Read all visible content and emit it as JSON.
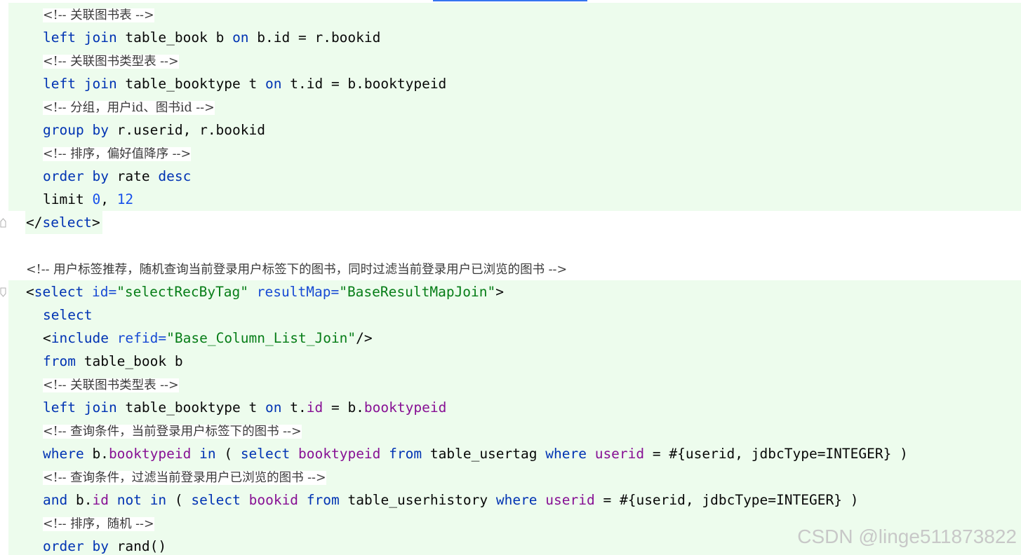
{
  "watermark": "CSDN @linge511873822",
  "lines": [
    {
      "kind": "comment",
      "tokens": [
        {
          "t": "<!-- 关联图书表 -->",
          "c": "cmt"
        }
      ]
    },
    {
      "kind": "code",
      "tokens": [
        {
          "t": "left",
          "c": "kw"
        },
        {
          "t": " ",
          "c": "txt"
        },
        {
          "t": "join",
          "c": "kw"
        },
        {
          "t": " table_book b ",
          "c": "txt"
        },
        {
          "t": "on",
          "c": "kw"
        },
        {
          "t": " b.id = r.bookid",
          "c": "txt"
        }
      ]
    },
    {
      "kind": "comment",
      "tokens": [
        {
          "t": "<!-- 关联图书类型表 -->",
          "c": "cmt"
        }
      ]
    },
    {
      "kind": "code",
      "tokens": [
        {
          "t": "left",
          "c": "kw"
        },
        {
          "t": " ",
          "c": "txt"
        },
        {
          "t": "join",
          "c": "kw"
        },
        {
          "t": " table_booktype t ",
          "c": "txt"
        },
        {
          "t": "on",
          "c": "kw"
        },
        {
          "t": " t.id = b.booktypeid",
          "c": "txt"
        }
      ]
    },
    {
      "kind": "comment",
      "tokens": [
        {
          "t": "<!-- 分组，用户id、图书id -->",
          "c": "cmt"
        }
      ]
    },
    {
      "kind": "code",
      "tokens": [
        {
          "t": "group",
          "c": "kw"
        },
        {
          "t": " ",
          "c": "txt"
        },
        {
          "t": "by",
          "c": "kw"
        },
        {
          "t": " r.userid, r.bookid",
          "c": "txt"
        }
      ]
    },
    {
      "kind": "comment",
      "tokens": [
        {
          "t": "<!-- 排序，偏好值降序 -->",
          "c": "cmt"
        }
      ]
    },
    {
      "kind": "code",
      "tokens": [
        {
          "t": "order",
          "c": "kw"
        },
        {
          "t": " ",
          "c": "txt"
        },
        {
          "t": "by",
          "c": "kw"
        },
        {
          "t": " rate ",
          "c": "txt"
        },
        {
          "t": "desc",
          "c": "kw"
        }
      ]
    },
    {
      "kind": "code",
      "tokens": [
        {
          "t": "limit ",
          "c": "txt"
        },
        {
          "t": "0",
          "c": "num"
        },
        {
          "t": ", ",
          "c": "txt"
        },
        {
          "t": "12",
          "c": "num"
        }
      ]
    },
    {
      "kind": "close-tag",
      "tokens": [
        {
          "t": "</",
          "c": "txt"
        },
        {
          "t": "select",
          "c": "tag"
        },
        {
          "t": ">",
          "c": "txt"
        }
      ]
    },
    {
      "kind": "blank",
      "tokens": []
    },
    {
      "kind": "comment-top",
      "tokens": [
        {
          "t": "<!-- 用户标签推荐，随机查询当前登录用户标签下的图书，同时过滤当前登录用户已浏览的图书 -->",
          "c": "cmt"
        }
      ]
    },
    {
      "kind": "open-tag",
      "tokens": [
        {
          "t": "<",
          "c": "txt"
        },
        {
          "t": "select",
          "c": "tag"
        },
        {
          "t": " ",
          "c": "txt"
        },
        {
          "t": "id",
          "c": "attr"
        },
        {
          "t": "=",
          "c": "attr"
        },
        {
          "t": "\"selectRecByTag\"",
          "c": "str"
        },
        {
          "t": " ",
          "c": "txt"
        },
        {
          "t": "resultMap",
          "c": "attr"
        },
        {
          "t": "=",
          "c": "attr"
        },
        {
          "t": "\"BaseResultMapJoin\"",
          "c": "str"
        },
        {
          "t": ">",
          "c": "txt"
        }
      ]
    },
    {
      "kind": "code",
      "tokens": [
        {
          "t": "select",
          "c": "kw"
        }
      ]
    },
    {
      "kind": "code",
      "tokens": [
        {
          "t": "<",
          "c": "txt"
        },
        {
          "t": "include",
          "c": "tag"
        },
        {
          "t": " ",
          "c": "txt"
        },
        {
          "t": "refid",
          "c": "attr"
        },
        {
          "t": "=",
          "c": "attr"
        },
        {
          "t": "\"Base_Column_List_Join\"",
          "c": "str"
        },
        {
          "t": "/>",
          "c": "txt"
        }
      ]
    },
    {
      "kind": "code",
      "tokens": [
        {
          "t": "from",
          "c": "kw"
        },
        {
          "t": " table_book b",
          "c": "txt"
        }
      ]
    },
    {
      "kind": "comment",
      "tokens": [
        {
          "t": "<!-- 关联图书类型表 -->",
          "c": "cmt"
        }
      ]
    },
    {
      "kind": "code",
      "tokens": [
        {
          "t": "left",
          "c": "kw"
        },
        {
          "t": " ",
          "c": "txt"
        },
        {
          "t": "join",
          "c": "kw"
        },
        {
          "t": " table_booktype t ",
          "c": "txt"
        },
        {
          "t": "on",
          "c": "kw"
        },
        {
          "t": " t.",
          "c": "txt"
        },
        {
          "t": "id",
          "c": "fld"
        },
        {
          "t": " = b.",
          "c": "txt"
        },
        {
          "t": "booktypeid",
          "c": "fld"
        }
      ]
    },
    {
      "kind": "comment",
      "tokens": [
        {
          "t": "<!-- 查询条件，当前登录用户标签下的图书 -->",
          "c": "cmt"
        }
      ]
    },
    {
      "kind": "code",
      "tokens": [
        {
          "t": "where",
          "c": "kw"
        },
        {
          "t": " b.",
          "c": "txt"
        },
        {
          "t": "booktypeid",
          "c": "fld"
        },
        {
          "t": " ",
          "c": "txt"
        },
        {
          "t": "in",
          "c": "kw"
        },
        {
          "t": " ( ",
          "c": "txt"
        },
        {
          "t": "select",
          "c": "kw"
        },
        {
          "t": " ",
          "c": "txt"
        },
        {
          "t": "booktypeid",
          "c": "fld"
        },
        {
          "t": " ",
          "c": "txt"
        },
        {
          "t": "from",
          "c": "kw"
        },
        {
          "t": " table_usertag ",
          "c": "txt"
        },
        {
          "t": "where",
          "c": "kw"
        },
        {
          "t": " ",
          "c": "txt"
        },
        {
          "t": "userid",
          "c": "fld"
        },
        {
          "t": " = #{userid, jdbcType=INTEGER} )",
          "c": "txt"
        }
      ]
    },
    {
      "kind": "comment",
      "tokens": [
        {
          "t": "<!-- 查询条件，过滤当前登录用户已浏览的图书 -->",
          "c": "cmt"
        }
      ]
    },
    {
      "kind": "code",
      "tokens": [
        {
          "t": "and",
          "c": "kw"
        },
        {
          "t": " b.",
          "c": "txt"
        },
        {
          "t": "id",
          "c": "fld"
        },
        {
          "t": " ",
          "c": "txt"
        },
        {
          "t": "not",
          "c": "kw"
        },
        {
          "t": " ",
          "c": "txt"
        },
        {
          "t": "in",
          "c": "kw"
        },
        {
          "t": " ( ",
          "c": "txt"
        },
        {
          "t": "select",
          "c": "kw"
        },
        {
          "t": " ",
          "c": "txt"
        },
        {
          "t": "bookid",
          "c": "fld"
        },
        {
          "t": " ",
          "c": "txt"
        },
        {
          "t": "from",
          "c": "kw"
        },
        {
          "t": " table_userhistory ",
          "c": "txt"
        },
        {
          "t": "where",
          "c": "kw"
        },
        {
          "t": " ",
          "c": "txt"
        },
        {
          "t": "userid",
          "c": "fld"
        },
        {
          "t": " = #{userid, jdbcType=INTEGER} )",
          "c": "txt"
        }
      ]
    },
    {
      "kind": "comment",
      "tokens": [
        {
          "t": "<!-- 排序，随机 -->",
          "c": "cmt"
        }
      ]
    },
    {
      "kind": "code",
      "tokens": [
        {
          "t": "order",
          "c": "kw"
        },
        {
          "t": " ",
          "c": "txt"
        },
        {
          "t": "by",
          "c": "kw"
        },
        {
          "t": " rand()",
          "c": "txt"
        }
      ]
    }
  ]
}
